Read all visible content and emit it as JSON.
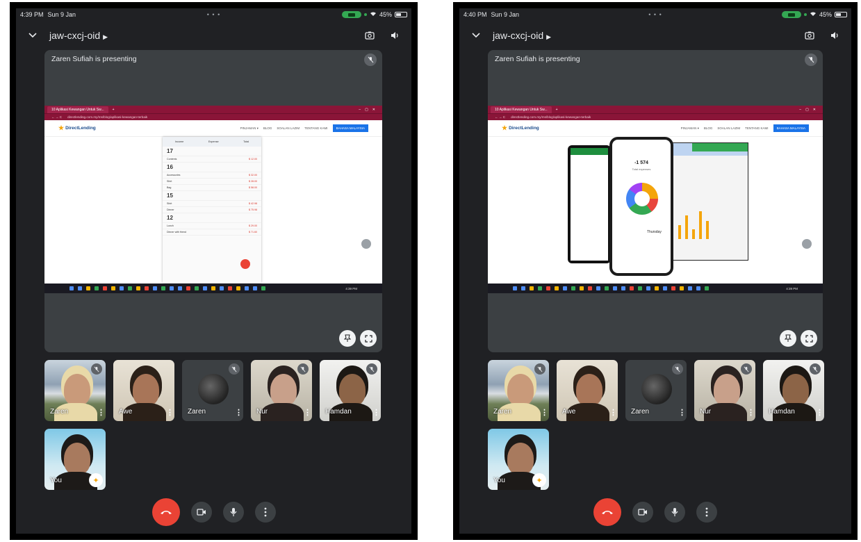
{
  "screens": [
    {
      "status": {
        "time": "4:39 PM",
        "date": "Sun 9 Jan",
        "battery": "45%"
      },
      "meeting": {
        "code": "jaw-cxcj-oid",
        "presenting_label": "Zaren Sufiah is presenting"
      },
      "shared_view": "expense-list",
      "participants": [
        {
          "name": "Zaren",
          "muted": true
        },
        {
          "name": "Awe",
          "muted": false
        },
        {
          "name": "Zaren",
          "muted": true
        },
        {
          "name": "Nur",
          "muted": true
        },
        {
          "name": "Hamdan",
          "muted": true
        },
        {
          "name": "You",
          "muted": false
        }
      ]
    },
    {
      "status": {
        "time": "4:40 PM",
        "date": "Sun 9 Jan",
        "battery": "45%"
      },
      "meeting": {
        "code": "jaw-cxcj-oid",
        "presenting_label": "Zaren Sufiah is presenting"
      },
      "shared_view": "app-promo",
      "participants": [
        {
          "name": "Zaren",
          "muted": true
        },
        {
          "name": "Awe",
          "muted": false
        },
        {
          "name": "Zaren",
          "muted": true
        },
        {
          "name": "Nur",
          "muted": true
        },
        {
          "name": "Hamdan",
          "muted": true
        },
        {
          "name": "You",
          "muted": false
        }
      ]
    }
  ],
  "website": {
    "tab_title": "10 Aplikasi Kewangan Untuk Sw...",
    "url": "directlending.com.my/ms/blog/aplikasi-kewangan-terbaik",
    "logo": "DirectLending",
    "nav": [
      "PINJAMAN ▾",
      "BLOG",
      "SOALAN LAZIM",
      "TENTANG KAMI"
    ],
    "cta": "BAHASA MALAYSIA"
  },
  "expense_list": {
    "headers": [
      "Income",
      "Expense",
      "Total"
    ],
    "rows": [
      {
        "type": "day",
        "label": "17",
        "amt": ""
      },
      {
        "type": "item",
        "label": "Contents",
        "amt": "$ 12.00"
      },
      {
        "type": "day",
        "label": "16",
        "amt": ""
      },
      {
        "type": "item",
        "label": "Accessories",
        "amt": "$ 32.00"
      },
      {
        "type": "item",
        "label": "Shirt",
        "amt": "$ 28.00"
      },
      {
        "type": "item",
        "label": "Bag",
        "amt": "$ 58.00"
      },
      {
        "type": "day",
        "label": "15",
        "amt": ""
      },
      {
        "type": "item",
        "label": "Shirt",
        "amt": "$ 42.98"
      },
      {
        "type": "item",
        "label": "Dinner",
        "amt": "$ 75.98"
      },
      {
        "type": "day",
        "label": "12",
        "amt": ""
      },
      {
        "type": "item",
        "label": "Lunch",
        "amt": "$ 29.00"
      },
      {
        "type": "item",
        "label": "Dinner with friend",
        "amt": "$ 71.60"
      }
    ]
  },
  "promo": {
    "total": "-1 574",
    "total_label": "Total expenses",
    "day": "Thursday"
  },
  "taskbar": {
    "clock": "4:39 PM"
  },
  "colors": {
    "end_call": "#ea4335",
    "panel": "#3c4043",
    "background": "#202124"
  }
}
